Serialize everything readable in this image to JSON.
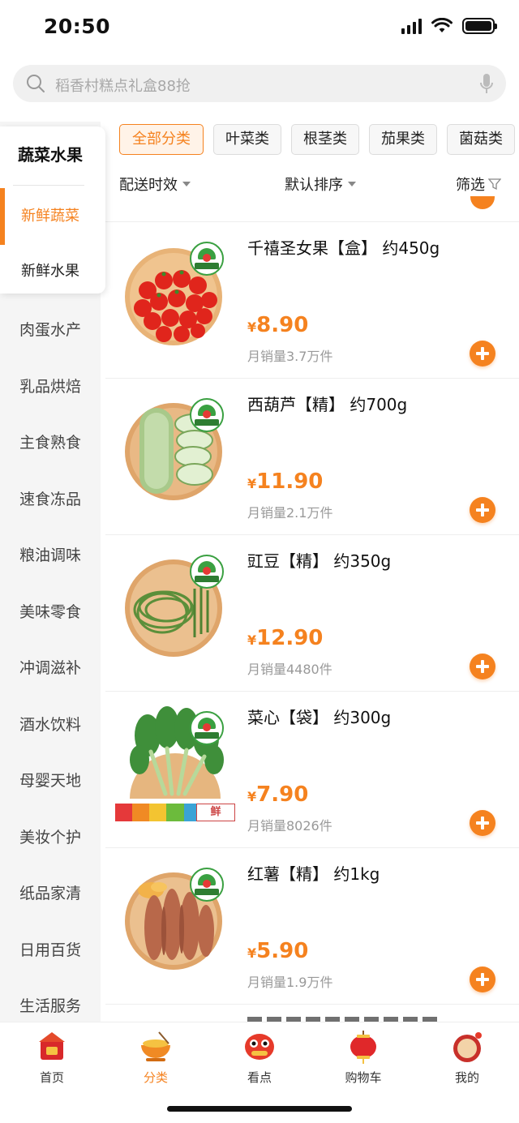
{
  "status": {
    "time": "20:50"
  },
  "search": {
    "placeholder": "稻香村糕点礼盒88抢"
  },
  "sidebar": {
    "current_category": "蔬菜水果",
    "subcategories": [
      {
        "label": "新鲜蔬菜",
        "active": true
      },
      {
        "label": "新鲜水果",
        "active": false
      }
    ],
    "items": [
      "肉蛋水产",
      "乳品烘焙",
      "主食熟食",
      "速食冻品",
      "粮油调味",
      "美味零食",
      "冲调滋补",
      "酒水饮料",
      "母婴天地",
      "美妆个护",
      "纸品家清",
      "日用百货",
      "生活服务"
    ]
  },
  "filters": {
    "chips": [
      {
        "label": "全部分类",
        "active": true
      },
      {
        "label": "叶菜类",
        "active": false
      },
      {
        "label": "根茎类",
        "active": false
      },
      {
        "label": "茄果类",
        "active": false
      },
      {
        "label": "菌菇类",
        "active": false
      }
    ]
  },
  "sort": {
    "delivery": "配送时效",
    "default": "默认排序",
    "filter": "筛选"
  },
  "products": [
    {
      "name": "千禧圣女果【盒】 约450g",
      "yen": "¥",
      "price": "8.90",
      "sales": "月销量3.7万件",
      "image": "cherry-tomatoes"
    },
    {
      "name": "西葫芦【精】 约700g",
      "yen": "¥",
      "price": "11.90",
      "sales": "月销量2.1万件",
      "image": "zucchini"
    },
    {
      "name": "豇豆【精】 约350g",
      "yen": "¥",
      "price": "12.90",
      "sales": "月销量4480件",
      "image": "long-beans"
    },
    {
      "name": "菜心【袋】 约300g",
      "yen": "¥",
      "price": "7.90",
      "sales": "月销量8026件",
      "image": "choy-sum"
    },
    {
      "name": "红薯【精】 约1kg",
      "yen": "¥",
      "price": "5.90",
      "sales": "月销量1.9万件",
      "image": "sweet-potato"
    }
  ],
  "tabbar": {
    "items": [
      {
        "label": "首页",
        "icon": "home-festive-icon",
        "active": false
      },
      {
        "label": "分类",
        "icon": "category-bowl-icon",
        "active": true
      },
      {
        "label": "看点",
        "icon": "lion-dance-icon",
        "active": false
      },
      {
        "label": "购物车",
        "icon": "lantern-cart-icon",
        "active": false
      },
      {
        "label": "我的",
        "icon": "drum-profile-icon",
        "active": false
      }
    ]
  },
  "colors": {
    "accent": "#f5821f",
    "badge_green": "#3aa041"
  }
}
